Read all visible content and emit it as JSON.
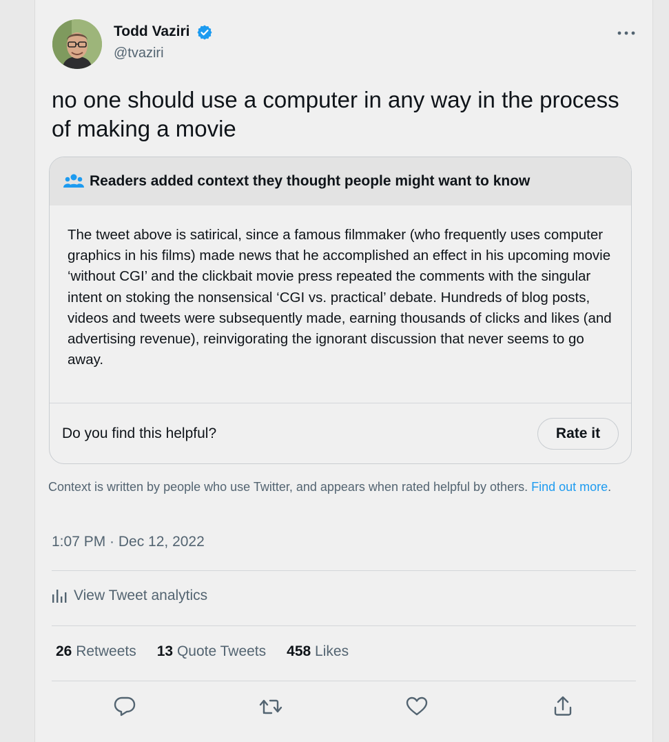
{
  "tweet": {
    "author_name": "Todd Vaziri",
    "author_handle": "@tvaziri",
    "text": "no one should use a computer in any way in the process of making a movie",
    "timestamp": "1:07 PM · Dec 12, 2022"
  },
  "community_note": {
    "title": "Readers added context they thought people might want to know",
    "body": "The tweet above is satirical, since a famous filmmaker (who frequently uses computer graphics in his films) made news that he accomplished an effect in his upcoming movie ‘without CGI’ and the clickbait movie press repeated the comments with the singular intent on stoking the nonsensical ‘CGI vs. practical’ debate. Hundreds of blog posts, videos and tweets were subsequently made, earning thousands of clicks and likes (and advertising revenue), reinvigorating the ignorant discussion that never seems to go away.",
    "helpful_question": "Do you find this helpful?",
    "rate_label": "Rate it"
  },
  "context_info": {
    "text": "Context is written by people who use Twitter, and appears when rated helpful by others. ",
    "link": "Find out more",
    "period": "."
  },
  "analytics_label": "View Tweet analytics",
  "stats": {
    "retweets_count": "26",
    "retweets_label": "Retweets",
    "quotes_count": "13",
    "quotes_label": "Quote Tweets",
    "likes_count": "458",
    "likes_label": "Likes"
  },
  "icons": [
    "verified-badge-icon",
    "more-icon",
    "people-icon",
    "analytics-icon",
    "reply-icon",
    "retweet-icon",
    "like-icon",
    "share-icon"
  ],
  "colors": {
    "accent": "#1d9bf0",
    "secondary_text": "#536471",
    "primary_text": "#0f1419"
  }
}
